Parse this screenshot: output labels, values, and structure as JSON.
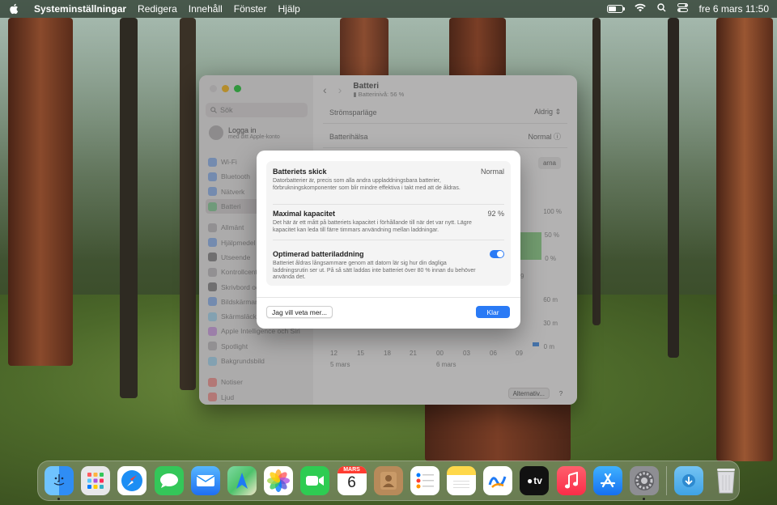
{
  "menubar": {
    "app_name": "Systeminställningar",
    "menus": [
      "Redigera",
      "Innehåll",
      "Fönster",
      "Hjälp"
    ],
    "clock": "fre 6 mars 11:50"
  },
  "sidebar": {
    "search_placeholder": "Sök",
    "account": {
      "title": "Logga in",
      "subtitle": "med ditt Apple-konto"
    },
    "items": [
      {
        "label": "Wi-Fi",
        "color": "#2a7af5"
      },
      {
        "label": "Bluetooth",
        "color": "#2a7af5"
      },
      {
        "label": "Nätverk",
        "color": "#2a7af5"
      },
      {
        "label": "Batteri",
        "color": "#34c759"
      },
      {
        "label": "Allmänt",
        "color": "#8e8e93"
      },
      {
        "label": "Hjälpmedel",
        "color": "#2a7af5"
      },
      {
        "label": "Utseende",
        "color": "#1c1c1e"
      },
      {
        "label": "Kontrollcenter",
        "color": "#8e8e93"
      },
      {
        "label": "Skrivbord och Dock",
        "color": "#1c1c1e"
      },
      {
        "label": "Bildskärmar",
        "color": "#2a7af5"
      },
      {
        "label": "Skärmsläckare",
        "color": "#5ac8fa"
      },
      {
        "label": "Apple Intelligence och Siri",
        "color": "#af52de"
      },
      {
        "label": "Spotlight",
        "color": "#8e8e93"
      },
      {
        "label": "Bakgrundsbild",
        "color": "#5ac8fa"
      },
      {
        "label": "Notiser",
        "color": "#ff3b30"
      },
      {
        "label": "Ljud",
        "color": "#ff3b30"
      }
    ]
  },
  "content": {
    "title": "Batteri",
    "subtitle": "Batterinivå: 56 %",
    "rows": [
      {
        "label": "Strömsparläge",
        "value": "Aldrig"
      },
      {
        "label": "Batterihälsa",
        "value": "Normal"
      }
    ],
    "partial_button": "arna",
    "chart_level_labels": [
      "100 %",
      "50 %",
      "0 %"
    ],
    "chart_time_labels": [
      "60 m",
      "30 m",
      "0 m"
    ],
    "x_ticks": [
      "12",
      "15",
      "18",
      "21",
      "00",
      "03",
      "06",
      "09"
    ],
    "date_labels": [
      "5 mars",
      "6 mars"
    ],
    "partial_tick": "9",
    "options_button": "Alternativ...",
    "help_button": "?"
  },
  "dialog": {
    "sections": [
      {
        "title": "Batteriets skick",
        "value": "Normal",
        "description": "Datorbatterier är, precis som alla andra uppladdningsbara batterier, förbrukningskomponenter som blir mindre effektiva i takt med att de åldras."
      },
      {
        "title": "Maximal kapacitet",
        "value": "92 %",
        "description": "Det här är ett mått på batteriets kapacitet i förhållande till när det var nytt. Lägre kapacitet kan leda till färre timmars användning mellan laddningar."
      },
      {
        "title": "Optimerad batteriladdning",
        "toggle_on": true,
        "description": "Batteriet åldras långsammare genom att datorn lär sig hur din dagliga laddningsrutin ser ut. På så sätt laddas inte batteriet över 80 % innan du behöver använda det."
      }
    ],
    "learn_more_button": "Jag vill veta mer...",
    "done_button": "Klar"
  },
  "dock": {
    "calendar_month": "MARS",
    "calendar_day": "6",
    "tv_label": "tv",
    "apps": [
      {
        "name": "finder-icon",
        "color": "#2f8df5"
      },
      {
        "name": "launchpad-icon",
        "color": "#e8e8ea"
      },
      {
        "name": "safari-icon",
        "color": "#ffffff"
      },
      {
        "name": "messages-icon",
        "color": "#34c759"
      },
      {
        "name": "mail-icon",
        "color": "#1f8ef6"
      },
      {
        "name": "maps-icon",
        "color": "#4cc26a"
      },
      {
        "name": "photos-icon",
        "color": "#ffffff"
      },
      {
        "name": "facetime-icon",
        "color": "#2ecc52"
      },
      {
        "name": "calendar-icon",
        "color": "#ffffff"
      },
      {
        "name": "contacts-icon",
        "color": "#b88a5a"
      },
      {
        "name": "reminders-icon",
        "color": "#ffffff"
      },
      {
        "name": "notes-icon",
        "color": "#ffd84a"
      },
      {
        "name": "freeform-icon",
        "color": "#ffffff"
      },
      {
        "name": "tv-icon",
        "color": "#111111"
      },
      {
        "name": "music-icon",
        "color": "#fa3c52"
      },
      {
        "name": "app-store-icon",
        "color": "#1d8ff6"
      },
      {
        "name": "system-settings-icon",
        "color": "#8e8e93"
      }
    ]
  }
}
